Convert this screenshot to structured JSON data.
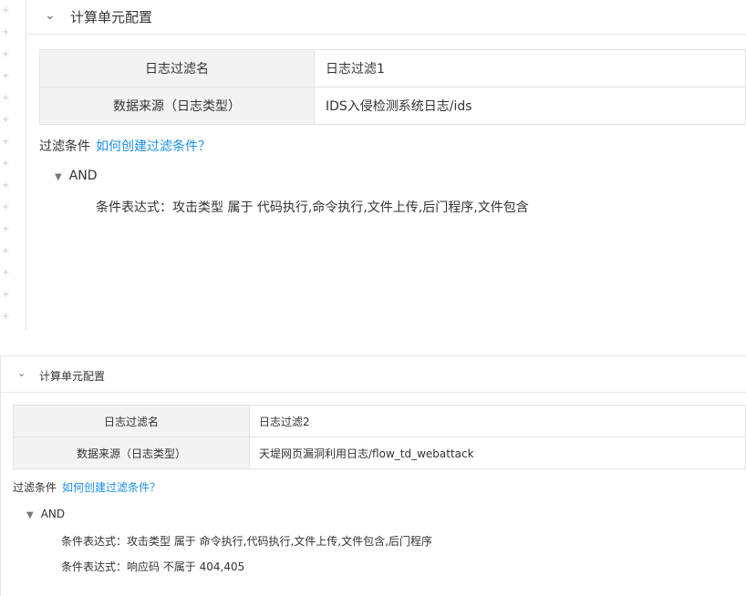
{
  "panel1": {
    "header_title": "计算单元配置",
    "rows": [
      {
        "label": "日志过滤名",
        "value": "日志过滤1"
      },
      {
        "label": "数据来源（日志类型）",
        "value": "IDS入侵检测系统日志/ids"
      }
    ],
    "filter_label": "过滤条件",
    "filter_link": "如何创建过滤条件？",
    "and_label": "AND",
    "conditions": [
      "条件表达式：攻击类型 属于 代码执行,命令执行,文件上传,后门程序,文件包含"
    ]
  },
  "panel2": {
    "header_title": "计算单元配置",
    "rows": [
      {
        "label": "日志过滤名",
        "value": "日志过滤2"
      },
      {
        "label": "数据来源（日志类型）",
        "value": "天堤网页漏洞利用日志/flow_td_webattack"
      }
    ],
    "filter_label": "过滤条件",
    "filter_link": "如何创建过滤条件？",
    "and_label": "AND",
    "conditions": [
      "条件表达式：攻击类型 属于 命令执行,代码执行,文件上传,文件包含,后门程序",
      "条件表达式：响应码 不属于 404,405"
    ]
  },
  "icons": {
    "collapse": "chevron-down-icon",
    "tree_toggle": "triangle-down-icon",
    "gutter": "plus-icon"
  },
  "colors": {
    "link": "#1a8ef0",
    "label_bg": "#f3f3f3",
    "border": "#e2e2e2"
  }
}
